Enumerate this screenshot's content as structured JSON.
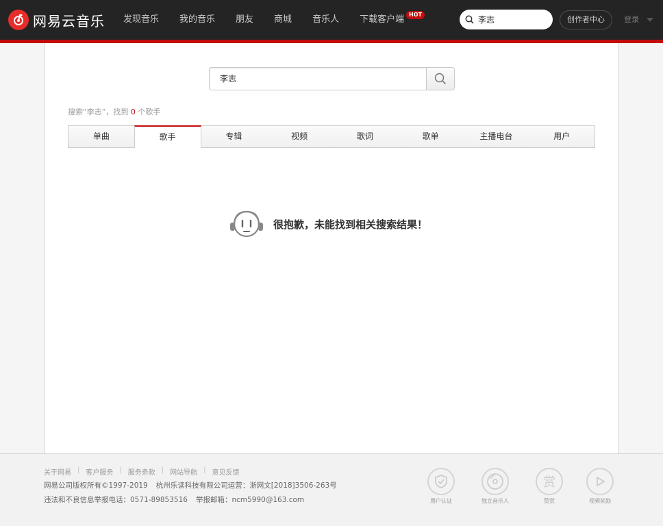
{
  "header": {
    "brand": "网易云音乐",
    "nav": [
      "发现音乐",
      "我的音乐",
      "朋友",
      "商城",
      "音乐人",
      "下载客户端"
    ],
    "hot_badge": "HOT",
    "search_value": "李志",
    "creator_center": "创作者中心",
    "login": "登录",
    "accent_color": "#c20c0c"
  },
  "search": {
    "value": "李志",
    "result_prefix": "搜索“李志”，找到 ",
    "result_count": "0",
    "result_suffix": " 个歌手"
  },
  "tabs": [
    "单曲",
    "歌手",
    "专辑",
    "视频",
    "歌词",
    "歌单",
    "主播电台",
    "用户"
  ],
  "active_tab": "歌手",
  "empty_message": "很抱歉，未能找到相关搜索结果！",
  "footer": {
    "links": [
      "关于网易",
      "客户服务",
      "服务条款",
      "网站导航",
      "意见反馈"
    ],
    "link_sep": "|",
    "copyright": "网易公司版权所有©1997-2019",
    "operator": "杭州乐读科技有限公司运营：浙网文[2018]3506-263号",
    "report_phone": "违法和不良信息举报电话：0571-89853516",
    "report_email": "举报邮箱：ncm5990@163.com",
    "badges": [
      {
        "label": "用户认证",
        "icon": "shield-check-icon"
      },
      {
        "label": "独立音乐人",
        "icon": "vinyl-icon"
      },
      {
        "label": "赞赏",
        "icon": "reward-icon",
        "glyph": "赏"
      },
      {
        "label": "视频奖励",
        "icon": "play-icon"
      }
    ]
  }
}
